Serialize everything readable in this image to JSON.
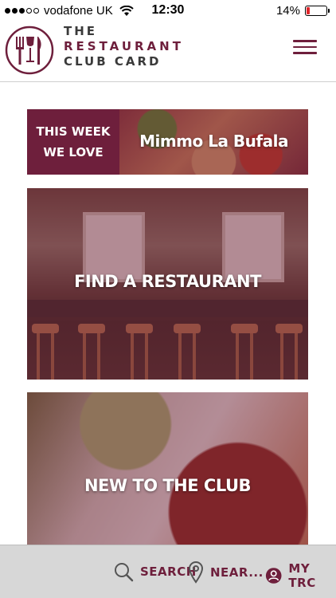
{
  "status_bar": {
    "carrier": "vodafone UK",
    "time": "12:30",
    "battery": "14%",
    "signal_icon": "signal-dots-icon",
    "wifi_icon": "wifi-icon",
    "battery_icon": "battery-icon"
  },
  "header": {
    "brand_line1": "THE",
    "brand_line2": "RESTAURANT",
    "brand_line3": "CLUB CARD",
    "logo_icon": "cutlery-logo-icon",
    "menu_icon": "hamburger-menu-icon"
  },
  "tiles": {
    "this_week": {
      "line1": "THIS WEEK",
      "line2": "WE LOVE",
      "restaurant": "Mimmo La Bufala"
    },
    "find": {
      "label": "FIND A RESTAURANT"
    },
    "new": {
      "label": "NEW TO THE CLUB"
    }
  },
  "bottom_nav": {
    "search": {
      "label": "SEARCH",
      "icon": "search-icon"
    },
    "near": {
      "label": "NEAR...",
      "icon": "location-pin-icon"
    },
    "mytrc": {
      "label": "MY TRC",
      "icon": "user-icon"
    }
  },
  "colors": {
    "brand": "#6e1f3c",
    "bar_bg": "#d7d7d7"
  }
}
